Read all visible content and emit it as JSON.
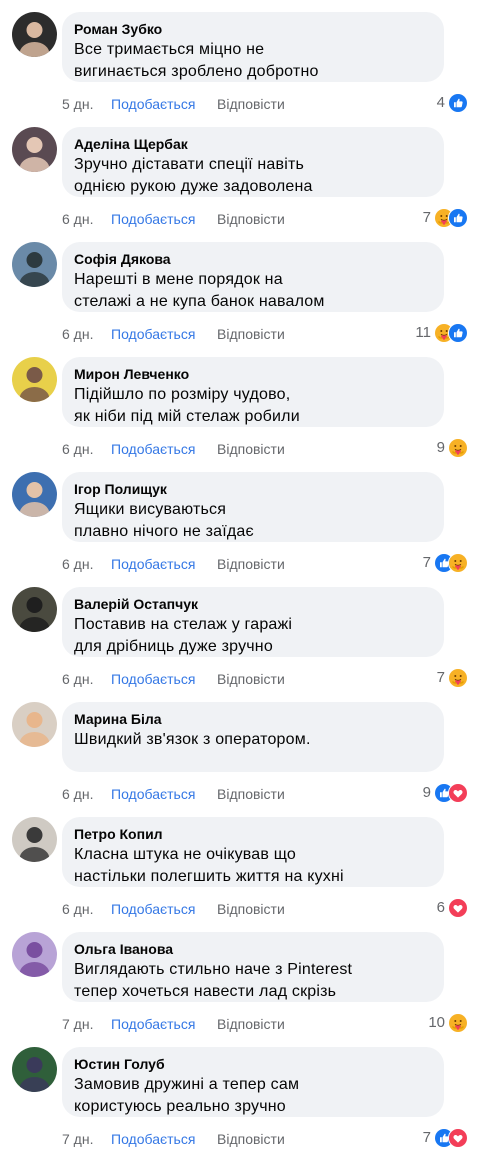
{
  "labels": {
    "like": "Подобається",
    "reply": "Відповісти"
  },
  "colors": {
    "like_blue": "#1877f2",
    "love_red": "#f33e58",
    "care_yellow": "#f7b125",
    "bubble": "#f0f2f5"
  },
  "comments": [
    {
      "author": "Роман Зубко",
      "text": "Все тримається міцно не вигинається зроблено добротно",
      "line1": "Все тримається міцно не",
      "line2": "вигинається зроблено добротно",
      "time": "5 дн.",
      "count": "4",
      "reactions": [
        "like-icon"
      ]
    },
    {
      "author": "Аделіна Щербак",
      "line1": "Зручно діставати спеції навіть",
      "line2": "однією рукою дуже задоволена",
      "time": "6 дн.",
      "count": "7",
      "reactions": [
        "care-icon",
        "like-icon"
      ]
    },
    {
      "author": "Софія Дякова",
      "line1": "Нарешті в мене порядок на",
      "line2": "стелажі а не купа банок навалом",
      "time": "6 дн.",
      "count": "11",
      "reactions": [
        "care-icon",
        "like-icon"
      ]
    },
    {
      "author": "Мирон Левченко",
      "line1": "Підійшло по розміру чудово,",
      "line2": "як ніби під мій стелаж робили",
      "time": "6 дн.",
      "count": "9",
      "reactions": [
        "care-icon"
      ]
    },
    {
      "author": "Ігор Полищук",
      "line1": "Ящики висуваються",
      "line2": "плавно нічого не заїдає",
      "time": "6 дн.",
      "count": "7",
      "reactions": [
        "like-icon",
        "care-icon"
      ]
    },
    {
      "author": "Валерій Остапчук",
      "line1": "Поставив на стелаж у гаражі",
      "line2": "для дрібниць дуже зручно",
      "time": "6 дн.",
      "count": "7",
      "reactions": [
        "care-icon"
      ]
    },
    {
      "author": "Марина Біла",
      "line1": "Швидкий зв'язок з оператором.",
      "line2": "",
      "time": "6 дн.",
      "count": "9",
      "reactions": [
        "like-icon",
        "love-icon"
      ]
    },
    {
      "author": "Петро Копил",
      "line1": "Класна штука не очікував що",
      "line2": "настільки полегшить життя на кухні",
      "time": "6 дн.",
      "count": "6",
      "reactions": [
        "love-icon"
      ]
    },
    {
      "author": "Ольга Іванова",
      "line1": "Виглядають стильно наче з Pinterest",
      "line2": "тепер хочеться навести лад скрізь",
      "time": "7 дн.",
      "count": "10",
      "reactions": [
        "care-icon"
      ]
    },
    {
      "author": "Юстин Голуб",
      "line1": "Замовив дружині а тепер сам",
      "line2": "користуюсь реально зручно",
      "time": "7 дн.",
      "count": "7",
      "reactions": [
        "like-icon",
        "love-icon"
      ]
    }
  ]
}
